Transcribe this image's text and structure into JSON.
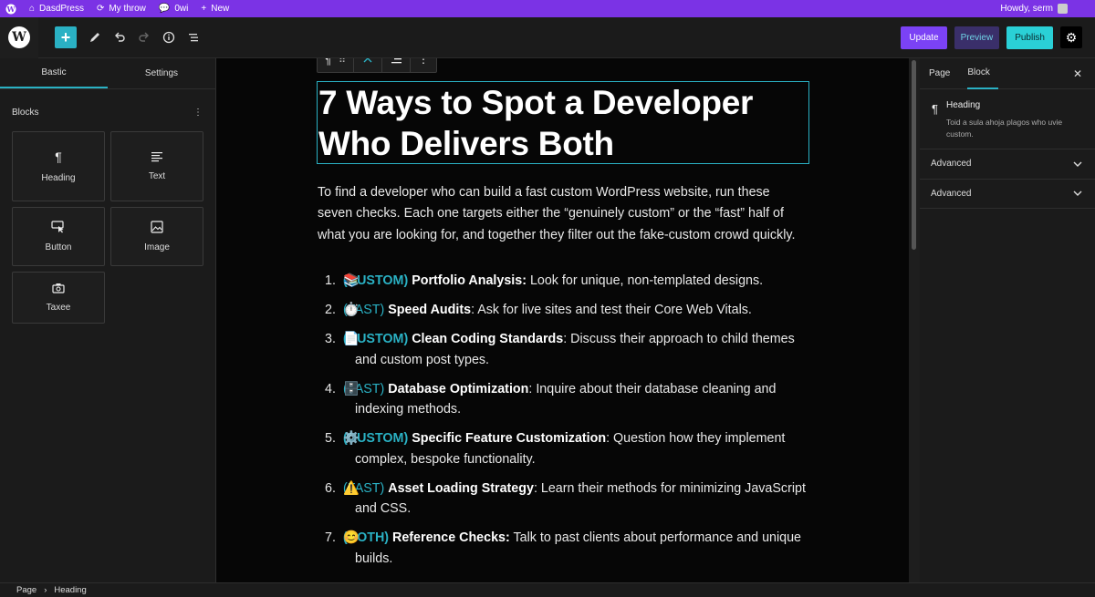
{
  "adminbar": {
    "site_name": "DasdPress",
    "updates_label": "My throw",
    "comments_count": "0wi",
    "new_label": "New",
    "howdy": "Howdy, serm"
  },
  "toolbar": {
    "update_label": "Update",
    "preview_label": "Preview",
    "publish_label": "Publish"
  },
  "left_sidebar": {
    "tabs": [
      "Bastic",
      "Settings"
    ],
    "blocks_heading": "Blocks",
    "blocks": [
      {
        "label": "Heading",
        "icon": "paragraph-icon"
      },
      {
        "label": "Text",
        "icon": "text-lines-icon"
      },
      {
        "label": "Button",
        "icon": "button-cursor-icon"
      },
      {
        "label": "Image",
        "icon": "image-icon"
      },
      {
        "label": "Taxee",
        "icon": "camera-icon"
      }
    ]
  },
  "content": {
    "heading": "7 Ways to Spot a Developer Who Delivers Both",
    "intro": "To find a developer who can build a fast custom WordPress website, run these seven checks. Each one targets either the “genuinely custom” or the “fast” half of what you are looking for, and together they filter out the fake-custom crowd quickly.",
    "items": [
      {
        "num": "1.",
        "emoji": "📚",
        "tag": "(CUSTOM)",
        "tag_bold": true,
        "title": "Portfolio Analysis:",
        "text": " Look for unique, non-templated designs."
      },
      {
        "num": "2.",
        "emoji": "⏱️",
        "tag": "(FAST)",
        "tag_bold": false,
        "title": "Speed Audits",
        "text": ": Ask for live sites and test their Core Web Vitals."
      },
      {
        "num": "3.",
        "emoji": "📄",
        "tag": "(CUSTOM)",
        "tag_bold": true,
        "title": "Clean Coding Standards",
        "text": ": Discuss their approach to child themes and custom post types."
      },
      {
        "num": "4.",
        "emoji": "🗄️",
        "tag": "(FAST)",
        "tag_bold": false,
        "title": "Database Optimization",
        "text": ": Inquire about their database cleaning and indexing methods."
      },
      {
        "num": "5.",
        "emoji": "⚙️",
        "tag": "(CUSTOM)",
        "tag_bold": true,
        "title": "Specific Feature Customization",
        "text": ": Question how they implement complex, bespoke functionality."
      },
      {
        "num": "6.",
        "emoji": "⚠️",
        "tag": "(FAST)",
        "tag_bold": false,
        "title": "Asset Loading Strategy",
        "text": ": Learn their methods for minimizing JavaScript and CSS."
      },
      {
        "num": "7.",
        "emoji": "😊",
        "tag": "(BOTH)",
        "tag_bold": true,
        "title": "Reference Checks:",
        "text": " Talk to past clients about performance and unique builds."
      }
    ]
  },
  "right_sidebar": {
    "tabs": [
      "Page",
      "Block"
    ],
    "block_name": "Heading",
    "block_desc": "Toid a sula ahoja plagos who uvie custom.",
    "panels": [
      "Advanced",
      "Advanced"
    ]
  },
  "footer": {
    "crumbs": [
      "Page",
      "Heading"
    ]
  },
  "colors": {
    "accent": "#2ab1c4",
    "adminbar": "#7b33e5",
    "update": "#7b42f5",
    "publish": "#2ad0d6"
  }
}
